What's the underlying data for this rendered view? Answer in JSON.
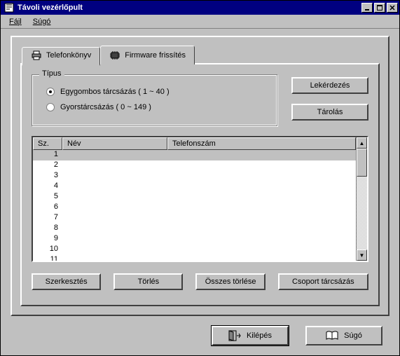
{
  "window": {
    "title": "Távoli vezérlőpult"
  },
  "menu": {
    "file": "Fájl",
    "help": "Súgó"
  },
  "tabs": {
    "phonebook": "Telefonkönyv",
    "firmware": "Firmware frissítés"
  },
  "type_group": {
    "legend": "Típus",
    "one_touch": "Egygombos tárcsázás ( 1 ~ 40 )",
    "speed": "Gyorstárcsázás ( 0 ~ 149 )",
    "selected": "one_touch"
  },
  "buttons": {
    "query": "Lekérdezés",
    "store": "Tárolás",
    "edit": "Szerkesztés",
    "delete": "Törlés",
    "delete_all": "Összes törlése",
    "group_dial": "Csoport tárcsázás",
    "exit": "Kilépés",
    "help": "Súgó"
  },
  "list": {
    "columns": {
      "sz": "Sz.",
      "nev": "Név",
      "tel": "Telefonszám"
    },
    "rows": [
      {
        "sz": "1",
        "nev": "",
        "tel": "",
        "selected": true
      },
      {
        "sz": "2",
        "nev": "",
        "tel": ""
      },
      {
        "sz": "3",
        "nev": "",
        "tel": ""
      },
      {
        "sz": "4",
        "nev": "",
        "tel": ""
      },
      {
        "sz": "5",
        "nev": "",
        "tel": ""
      },
      {
        "sz": "6",
        "nev": "",
        "tel": ""
      },
      {
        "sz": "7",
        "nev": "",
        "tel": ""
      },
      {
        "sz": "8",
        "nev": "",
        "tel": ""
      },
      {
        "sz": "9",
        "nev": "",
        "tel": ""
      },
      {
        "sz": "10",
        "nev": "",
        "tel": ""
      },
      {
        "sz": "11",
        "nev": "",
        "tel": ""
      }
    ]
  }
}
